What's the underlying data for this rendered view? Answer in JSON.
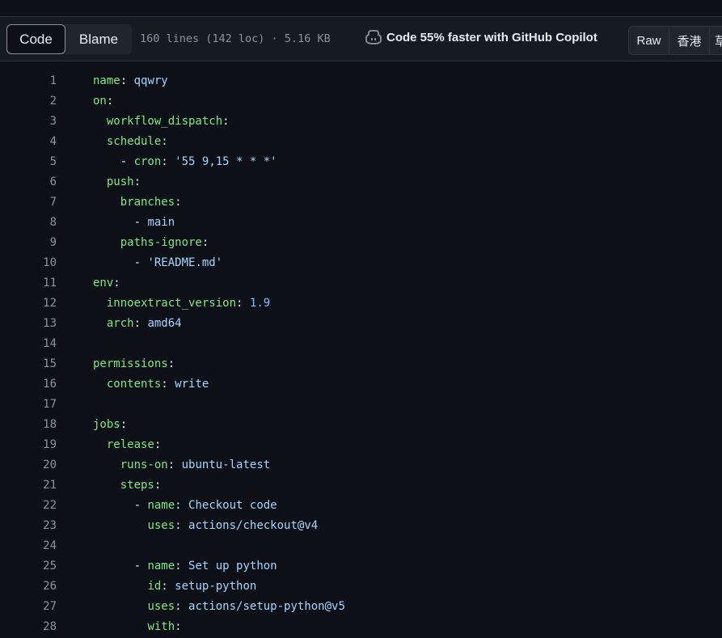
{
  "header": {
    "tab_code": "Code",
    "tab_blame": "Blame",
    "file_stats": "160 lines (142 loc) · 5.16 KB",
    "copilot_text": "Code 55% faster with GitHub Copilot",
    "raw_label": "Raw",
    "hk_label": "香港",
    "cut_label": "草"
  },
  "colors": {
    "background": "#0d1117",
    "header_bg": "#161b22",
    "key": "#7ee787",
    "string": "#a5d6ff",
    "number": "#79c0ff",
    "line_number": "#8b949e"
  },
  "lines": [
    {
      "num": "1",
      "indent": "",
      "dash": "",
      "key": "name",
      "colon": ":",
      "val": "qqwry",
      "val_type": "string"
    },
    {
      "num": "2",
      "indent": "",
      "dash": "",
      "key": "on",
      "colon": ":",
      "val": "",
      "val_type": ""
    },
    {
      "num": "3",
      "indent": "  ",
      "dash": "",
      "key": "workflow_dispatch",
      "colon": ":",
      "val": "",
      "val_type": ""
    },
    {
      "num": "4",
      "indent": "  ",
      "dash": "",
      "key": "schedule",
      "colon": ":",
      "val": "",
      "val_type": ""
    },
    {
      "num": "5",
      "indent": "    ",
      "dash": "- ",
      "key": "cron",
      "colon": ":",
      "val": "'55 9,15 * * *'",
      "val_type": "string"
    },
    {
      "num": "6",
      "indent": "  ",
      "dash": "",
      "key": "push",
      "colon": ":",
      "val": "",
      "val_type": ""
    },
    {
      "num": "7",
      "indent": "    ",
      "dash": "",
      "key": "branches",
      "colon": ":",
      "val": "",
      "val_type": ""
    },
    {
      "num": "8",
      "indent": "      ",
      "dash": "- ",
      "key": "",
      "colon": "",
      "val": "main",
      "val_type": "string"
    },
    {
      "num": "9",
      "indent": "    ",
      "dash": "",
      "key": "paths-ignore",
      "colon": ":",
      "val": "",
      "val_type": ""
    },
    {
      "num": "10",
      "indent": "      ",
      "dash": "- ",
      "key": "",
      "colon": "",
      "val": "'README.md'",
      "val_type": "string"
    },
    {
      "num": "11",
      "indent": "",
      "dash": "",
      "key": "env",
      "colon": ":",
      "val": "",
      "val_type": ""
    },
    {
      "num": "12",
      "indent": "  ",
      "dash": "",
      "key": "innoextract_version",
      "colon": ":",
      "val": "1.9",
      "val_type": "number"
    },
    {
      "num": "13",
      "indent": "  ",
      "dash": "",
      "key": "arch",
      "colon": ":",
      "val": "amd64",
      "val_type": "string"
    },
    {
      "num": "14",
      "indent": "",
      "dash": "",
      "key": "",
      "colon": "",
      "val": "",
      "val_type": ""
    },
    {
      "num": "15",
      "indent": "",
      "dash": "",
      "key": "permissions",
      "colon": ":",
      "val": "",
      "val_type": ""
    },
    {
      "num": "16",
      "indent": "  ",
      "dash": "",
      "key": "contents",
      "colon": ":",
      "val": "write",
      "val_type": "string"
    },
    {
      "num": "17",
      "indent": "",
      "dash": "",
      "key": "",
      "colon": "",
      "val": "",
      "val_type": ""
    },
    {
      "num": "18",
      "indent": "",
      "dash": "",
      "key": "jobs",
      "colon": ":",
      "val": "",
      "val_type": ""
    },
    {
      "num": "19",
      "indent": "  ",
      "dash": "",
      "key": "release",
      "colon": ":",
      "val": "",
      "val_type": ""
    },
    {
      "num": "20",
      "indent": "    ",
      "dash": "",
      "key": "runs-on",
      "colon": ":",
      "val": "ubuntu-latest",
      "val_type": "string"
    },
    {
      "num": "21",
      "indent": "    ",
      "dash": "",
      "key": "steps",
      "colon": ":",
      "val": "",
      "val_type": ""
    },
    {
      "num": "22",
      "indent": "      ",
      "dash": "- ",
      "key": "name",
      "colon": ":",
      "val": "Checkout code",
      "val_type": "string"
    },
    {
      "num": "23",
      "indent": "        ",
      "dash": "",
      "key": "uses",
      "colon": ":",
      "val": "actions/checkout@v4",
      "val_type": "string"
    },
    {
      "num": "24",
      "indent": "",
      "dash": "",
      "key": "",
      "colon": "",
      "val": "",
      "val_type": ""
    },
    {
      "num": "25",
      "indent": "      ",
      "dash": "- ",
      "key": "name",
      "colon": ":",
      "val": "Set up python",
      "val_type": "string"
    },
    {
      "num": "26",
      "indent": "        ",
      "dash": "",
      "key": "id",
      "colon": ":",
      "val": "setup-python",
      "val_type": "string"
    },
    {
      "num": "27",
      "indent": "        ",
      "dash": "",
      "key": "uses",
      "colon": ":",
      "val": "actions/setup-python@v5",
      "val_type": "string"
    },
    {
      "num": "28",
      "indent": "        ",
      "dash": "",
      "key": "with",
      "colon": ":",
      "val": "",
      "val_type": ""
    }
  ]
}
